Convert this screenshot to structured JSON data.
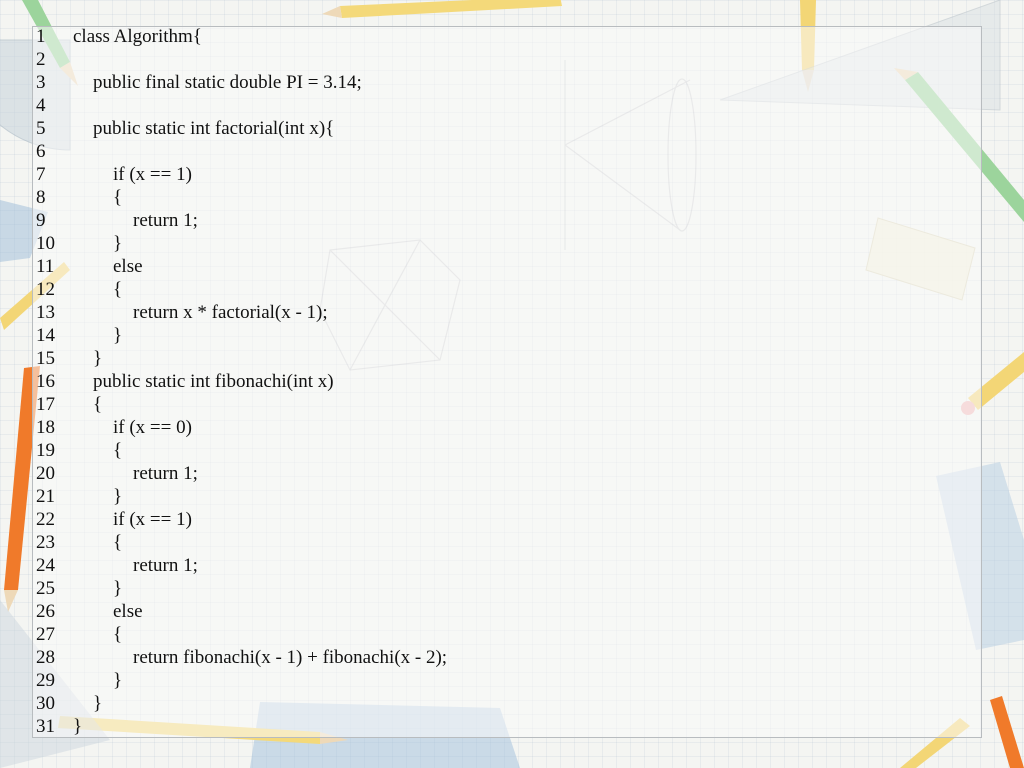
{
  "slide": {
    "lines": [
      {
        "n": "1",
        "indent": 0,
        "text": "class Algorithm{"
      },
      {
        "n": "2",
        "indent": 0,
        "text": ""
      },
      {
        "n": "3",
        "indent": 1,
        "text": "public final static double PI = 3.14;"
      },
      {
        "n": "4",
        "indent": 0,
        "text": ""
      },
      {
        "n": "5",
        "indent": 1,
        "text": "public static int factorial(int x){"
      },
      {
        "n": "6",
        "indent": 0,
        "text": ""
      },
      {
        "n": "7",
        "indent": 2,
        "text": "if (x == 1)"
      },
      {
        "n": "8",
        "indent": 2,
        "text": "{"
      },
      {
        "n": "9",
        "indent": 3,
        "text": "return 1;"
      },
      {
        "n": "10",
        "indent": 2,
        "text": "}"
      },
      {
        "n": "11",
        "indent": 2,
        "text": "else"
      },
      {
        "n": "12",
        "indent": 2,
        "text": "{"
      },
      {
        "n": "13",
        "indent": 3,
        "text": "return x * factorial(x - 1);"
      },
      {
        "n": "14",
        "indent": 2,
        "text": "}"
      },
      {
        "n": "15",
        "indent": 1,
        "text": "}"
      },
      {
        "n": "16",
        "indent": 1,
        "text": "public static int fibonachi(int x)"
      },
      {
        "n": "17",
        "indent": 1,
        "text": "{"
      },
      {
        "n": "18",
        "indent": 2,
        "text": "if (x == 0)"
      },
      {
        "n": "19",
        "indent": 2,
        "text": "{"
      },
      {
        "n": "20",
        "indent": 3,
        "text": "return 1;"
      },
      {
        "n": "21",
        "indent": 2,
        "text": "}"
      },
      {
        "n": "22",
        "indent": 2,
        "text": "if (x == 1)"
      },
      {
        "n": "23",
        "indent": 2,
        "text": "{"
      },
      {
        "n": "24",
        "indent": 3,
        "text": "return 1;"
      },
      {
        "n": "25",
        "indent": 2,
        "text": "}"
      },
      {
        "n": "26",
        "indent": 2,
        "text": "else"
      },
      {
        "n": "27",
        "indent": 2,
        "text": "{"
      },
      {
        "n": "28",
        "indent": 3,
        "text": "return fibonachi(x - 1) + fibonachi(x - 2);"
      },
      {
        "n": "29",
        "indent": 2,
        "text": "}"
      },
      {
        "n": "30",
        "indent": 1,
        "text": "}"
      },
      {
        "n": "31",
        "indent": 0,
        "text": "}"
      }
    ]
  },
  "colors": {
    "text": "#111111",
    "frame": "#b8bcbf",
    "pencil_yellow": "#f2d36a",
    "pencil_green": "#8ccf8c",
    "pencil_orange": "#f07a2a",
    "ruler_blue": "#a9c4dc"
  }
}
